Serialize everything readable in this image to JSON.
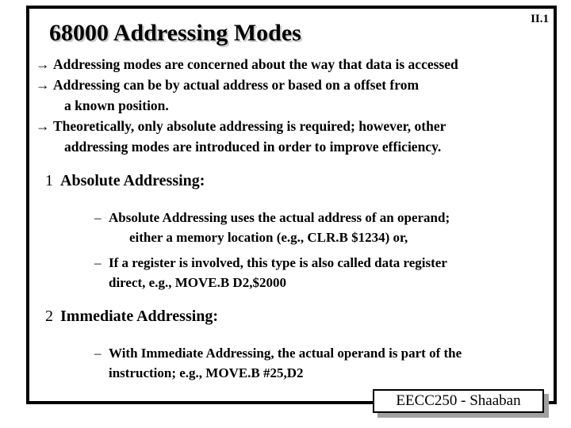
{
  "slide": {
    "page_number": "II.1",
    "title": "68000 Addressing Modes",
    "bullet_marker": "→",
    "dash_marker": "–",
    "intro_bullets": [
      {
        "marker": "→",
        "line1": "Addressing modes are concerned about the way that data is accessed"
      },
      {
        "marker": "→",
        "line1": "Addressing can be by actual address or based on a offset from",
        "line2": "a known position."
      },
      {
        "marker": "→",
        "line1": "Theoretically, only absolute addressing is required; however, other",
        "line2": "addressing modes are introduced in order to  improve efficiency."
      }
    ],
    "sections": [
      {
        "number": "1",
        "heading": "Absolute Addressing:",
        "items": [
          {
            "marker": "–",
            "line1": "Absolute Addressing uses the actual address of an operand;",
            "line2": "either a memory location  (e.g.,   CLR.B $1234)    or,",
            "line2_indent": "deep"
          },
          {
            "marker": "–",
            "line1": "If a register is involved, this type is also called data register",
            "line2": "direct,   e.g.,  MOVE.B  D2,$2000",
            "line2_indent": "flush"
          }
        ]
      },
      {
        "number": "2",
        "heading": "Immediate Addressing:",
        "items": [
          {
            "marker": "–",
            "line1": "With Immediate Addressing, the actual operand is part of the",
            "line2": "instruction;  e.g.,  MOVE.B  #25,D2",
            "line2_indent": "flush"
          }
        ]
      }
    ],
    "footer": {
      "label": "EECC250 - Shaaban"
    }
  },
  "colors": {
    "frame": "#000000",
    "background": "#ffffff",
    "title_shadow": "#c9c9c9",
    "badge_shadow": "#a0a0a0",
    "text": "#000000"
  }
}
